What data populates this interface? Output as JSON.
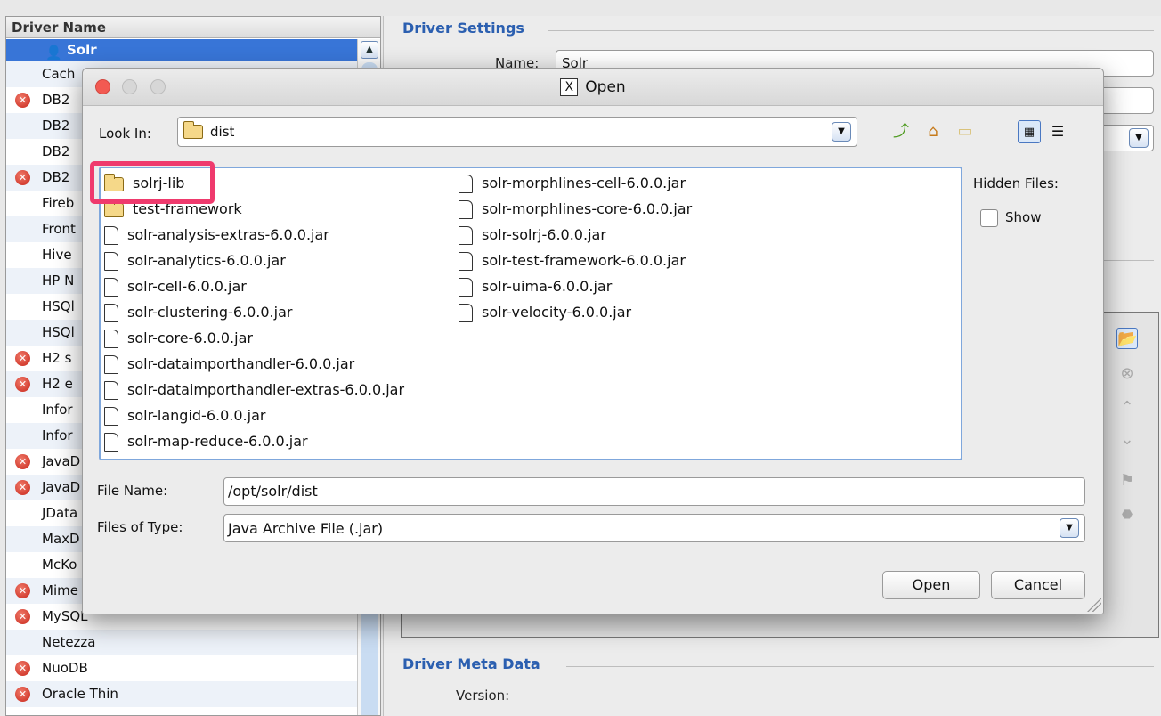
{
  "driver_list": {
    "header": "Driver Name",
    "selected": "Solr",
    "rows": [
      {
        "label": "Cach",
        "error": false
      },
      {
        "label": "DB2",
        "error": true
      },
      {
        "label": "DB2",
        "error": false
      },
      {
        "label": "DB2",
        "error": false
      },
      {
        "label": "DB2",
        "error": true
      },
      {
        "label": "Fireb",
        "error": false
      },
      {
        "label": "Front",
        "error": false
      },
      {
        "label": "Hive",
        "error": false
      },
      {
        "label": "HP N",
        "error": false
      },
      {
        "label": "HSQl",
        "error": false
      },
      {
        "label": "HSQl",
        "error": false
      },
      {
        "label": "H2 s",
        "error": true
      },
      {
        "label": "H2 e",
        "error": true
      },
      {
        "label": "Infor",
        "error": false
      },
      {
        "label": "Infor",
        "error": false
      },
      {
        "label": "JavaD",
        "error": true
      },
      {
        "label": "JavaD",
        "error": true
      },
      {
        "label": "JData",
        "error": false
      },
      {
        "label": "MaxD",
        "error": false
      },
      {
        "label": "McKo",
        "error": false
      },
      {
        "label": "Mime",
        "error": true
      },
      {
        "label": "MySQL",
        "error": true
      },
      {
        "label": "Netezza",
        "error": false
      },
      {
        "label": "NuoDB",
        "error": true
      },
      {
        "label": "Oracle Thin",
        "error": true
      }
    ]
  },
  "driver_settings": {
    "title": "Driver Settings",
    "name_label": "Name:",
    "name_value": "Solr"
  },
  "driver_meta": {
    "title": "Driver Meta Data",
    "version_label": "Version:"
  },
  "dialog": {
    "title": "Open",
    "look_in_label": "Look In:",
    "look_in_value": "dist",
    "hidden_files_label": "Hidden Files:",
    "show_label": "Show",
    "file_name_label": "File Name:",
    "file_name_value": "/opt/solr/dist",
    "files_of_type_label": "Files of Type:",
    "files_of_type_value": "Java Archive File (.jar)",
    "open_button": "Open",
    "cancel_button": "Cancel",
    "files_col1": [
      {
        "name": "solrj-lib",
        "type": "folder"
      },
      {
        "name": "test-framework",
        "type": "folder"
      },
      {
        "name": "solr-analysis-extras-6.0.0.jar",
        "type": "file"
      },
      {
        "name": "solr-analytics-6.0.0.jar",
        "type": "file"
      },
      {
        "name": "solr-cell-6.0.0.jar",
        "type": "file"
      },
      {
        "name": "solr-clustering-6.0.0.jar",
        "type": "file"
      },
      {
        "name": "solr-core-6.0.0.jar",
        "type": "file"
      },
      {
        "name": "solr-dataimporthandler-6.0.0.jar",
        "type": "file"
      },
      {
        "name": "solr-dataimporthandler-extras-6.0.0.jar",
        "type": "file"
      },
      {
        "name": "solr-langid-6.0.0.jar",
        "type": "file"
      },
      {
        "name": "solr-map-reduce-6.0.0.jar",
        "type": "file"
      }
    ],
    "files_col2": [
      {
        "name": "solr-morphlines-cell-6.0.0.jar",
        "type": "file"
      },
      {
        "name": "solr-morphlines-core-6.0.0.jar",
        "type": "file"
      },
      {
        "name": "solr-solrj-6.0.0.jar",
        "type": "file"
      },
      {
        "name": "solr-test-framework-6.0.0.jar",
        "type": "file"
      },
      {
        "name": "solr-uima-6.0.0.jar",
        "type": "file"
      },
      {
        "name": "solr-velocity-6.0.0.jar",
        "type": "file"
      }
    ]
  },
  "colors": {
    "highlight": "#ef3a6d",
    "selection": "#3875d7",
    "section_title": "#2b5fb0"
  }
}
